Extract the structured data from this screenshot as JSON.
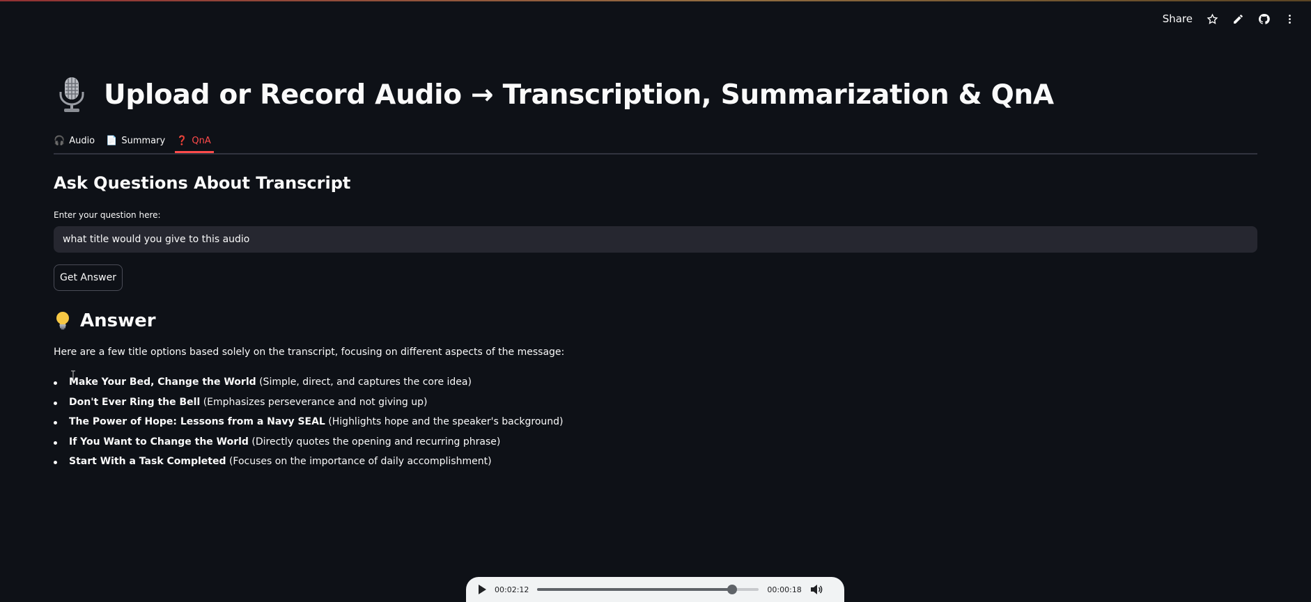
{
  "toolbar": {
    "share_label": "Share",
    "icons": [
      "star-icon",
      "pencil-icon",
      "github-icon",
      "kebab-menu-icon"
    ]
  },
  "header": {
    "icon": "microphone-icon",
    "title": "Upload or Record Audio → Transcription, Summarization & QnA"
  },
  "tabs": [
    {
      "icon": "headphones-icon",
      "glyph": "🎧",
      "label": "Audio",
      "active": false
    },
    {
      "icon": "document-icon",
      "glyph": "📄",
      "label": "Summary",
      "active": false
    },
    {
      "icon": "question-mark-icon",
      "glyph": "❓",
      "label": "QnA",
      "active": true
    }
  ],
  "qna": {
    "subheader": "Ask Questions About Transcript",
    "input_label": "Enter your question here:",
    "input_value": "what title would you give to this audio",
    "button_label": "Get Answer"
  },
  "answer": {
    "icon": "lightbulb-icon",
    "heading": "Answer",
    "intro": "Here are a few title options based solely on the transcript, focusing on different aspects of the message:",
    "items": [
      {
        "title": "Make Your Bed, Change the World",
        "note": "(Simple, direct, and captures the core idea)"
      },
      {
        "title": "Don't Ever Ring the Bell",
        "note": "(Emphasizes perseverance and not giving up)"
      },
      {
        "title": "The Power of Hope: Lessons from a Navy SEAL",
        "note": "(Highlights hope and the speaker's background)"
      },
      {
        "title": "If You Want to Change the World",
        "note": "(Directly quotes the opening and recurring phrase)"
      },
      {
        "title": "Start With a Task Completed",
        "note": "(Focuses on the importance of daily accomplishment)"
      }
    ]
  },
  "player": {
    "current_time": "00:02:12",
    "remaining_time": "00:00:18",
    "progress": 0.88
  },
  "colors": {
    "background": "#0e1117",
    "accent": "#ff4b4b",
    "input_bg": "#262730",
    "text": "#fafafa"
  }
}
